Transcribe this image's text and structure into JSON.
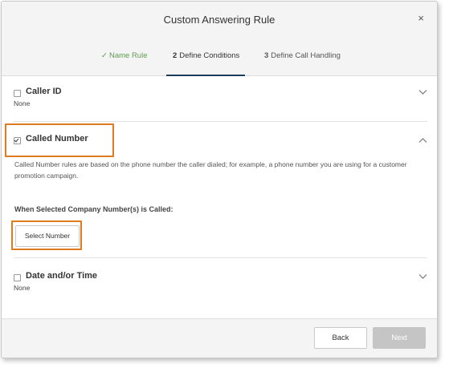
{
  "dialog": {
    "title": "Custom Answering Rule",
    "close_icon": "close-icon",
    "close_glyph": "×"
  },
  "steps": [
    {
      "num": "✓",
      "label": "Name Rule",
      "state": "done"
    },
    {
      "num": "2",
      "label": "Define Conditions",
      "state": "active"
    },
    {
      "num": "3",
      "label": "Define Call Handling",
      "state": "future"
    }
  ],
  "sections": {
    "caller_id": {
      "label": "Caller ID",
      "value": "None",
      "checked": false,
      "icon": "chevron-down-icon"
    },
    "called_number": {
      "label": "Called Number",
      "checked": true,
      "icon": "chevron-up-icon",
      "description": "Called Number rules are based on the phone number the caller dialed; for example, a phone number you are using for a customer promotion campaign.",
      "subheading": "When Selected Company Number(s) is Called:",
      "select_button": "Select Number"
    },
    "date_time": {
      "label": "Date and/or Time",
      "value": "None",
      "checked": false,
      "icon": "chevron-down-icon"
    }
  },
  "footer": {
    "back_label": "Back",
    "next_label": "Next"
  },
  "colors": {
    "highlight": "#e07a1f",
    "step_done": "#5aa24a",
    "step_active_underline": "#1f3b5c",
    "next_disabled": "#c5c5c5"
  }
}
